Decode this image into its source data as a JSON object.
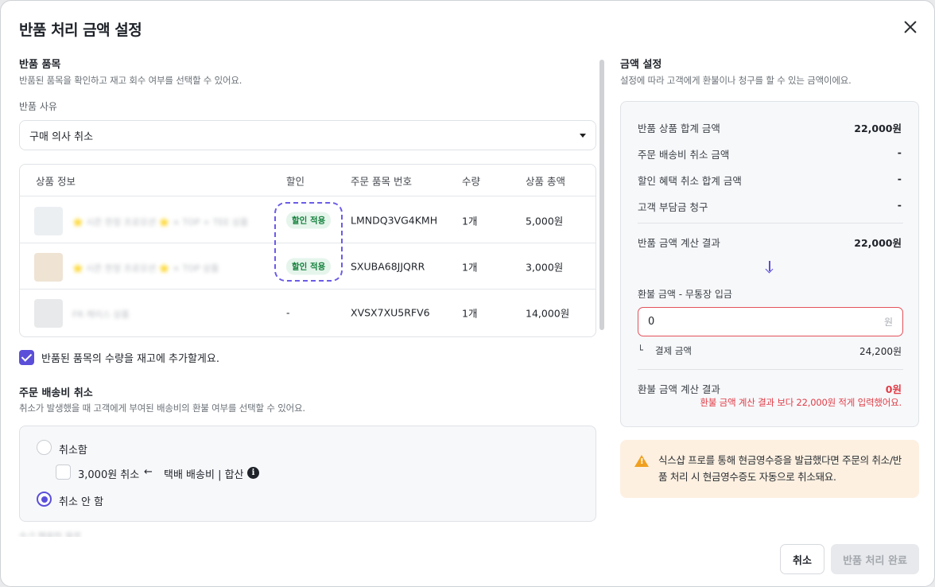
{
  "modal": {
    "title": "반품 처리 금액 설정"
  },
  "items_section": {
    "title": "반품 품목",
    "desc": "반품된 품목을 확인하고 재고 회수 여부를 선택할 수 있어요.",
    "reason_label": "반품 사유",
    "reason_value": "구매 의사 취소"
  },
  "table": {
    "headers": [
      "상품 정보",
      "할인",
      "주문 품목 번호",
      "수량",
      "상품 총액"
    ],
    "rows": [
      {
        "name": "⭐ 시즌 한정 프로모션 ⭐ × TOP + TEE 상품",
        "discount": "할인 적용",
        "order_no": "LMNDQ3VG4KMH",
        "qty": "1개",
        "total": "5,000원"
      },
      {
        "name": "⭐ 시즌 한정 프로모션 ⭐ × TOP 상품",
        "discount": "할인 적용",
        "order_no": "SXUBA68JJQRR",
        "qty": "1개",
        "total": "3,000원"
      },
      {
        "name": "FR 케이스 상품",
        "discount": "-",
        "order_no": "XVSX7XU5RFV6",
        "qty": "1개",
        "total": "14,000원"
      }
    ]
  },
  "restock_label": "반품된 품목의 수량을 재고에 추가할게요.",
  "shipping": {
    "title": "주문 배송비 취소",
    "desc": "취소가 발생했을 때 고객에게 부여된 배송비의 환불 여부를 선택할 수 있어요.",
    "opt_cancel": "취소함",
    "fee_check": "3,000원 취소",
    "fee_arrow": "←",
    "fee_note": "택배 배송비 | 합산",
    "info_glyph": "i",
    "opt_no_cancel": "취소 안 함"
  },
  "amount": {
    "title": "금액 설정",
    "desc": "설정에 따라 고객에게 환불이나 청구를 할 수 있는 금액이에요.",
    "rows": [
      {
        "label": "반품 상품 합계 금액",
        "value": "22,000원"
      },
      {
        "label": "주문 배송비 취소 금액",
        "value": "-"
      },
      {
        "label": "할인 혜택 취소 합계 금액",
        "value": "-"
      },
      {
        "label": "고객 부담금 청구",
        "value": "-"
      }
    ],
    "result_label": "반품 금액 계산 결과",
    "result_value": "22,000원",
    "refund_label": "환불 금액 - 무통장 입금",
    "refund_input": "0",
    "refund_unit": "원",
    "pay_prefix": "└",
    "pay_label": "결제 금액",
    "pay_value": "24,200원",
    "refund_result_label": "환불 금액 계산 결과",
    "refund_result_value": "0원",
    "error": "환불 금액 계산 결과 보다 22,000원 적게 입력했어요."
  },
  "notice": {
    "glyph": "!",
    "text": "식스샵 프로를 통해 현금영수증을 발급했다면 주문의 취소/반품 처리 시 현금영수증도 자동으로 취소돼요."
  },
  "buttons": {
    "cancel": "취소",
    "done": "반품 처리 완료"
  },
  "colors": {
    "accent": "#5b4fd9",
    "error": "#e03c46",
    "badge_bg": "#e6f5ec",
    "badge_text": "#14803c",
    "warn_bg": "#fdf0e1"
  }
}
